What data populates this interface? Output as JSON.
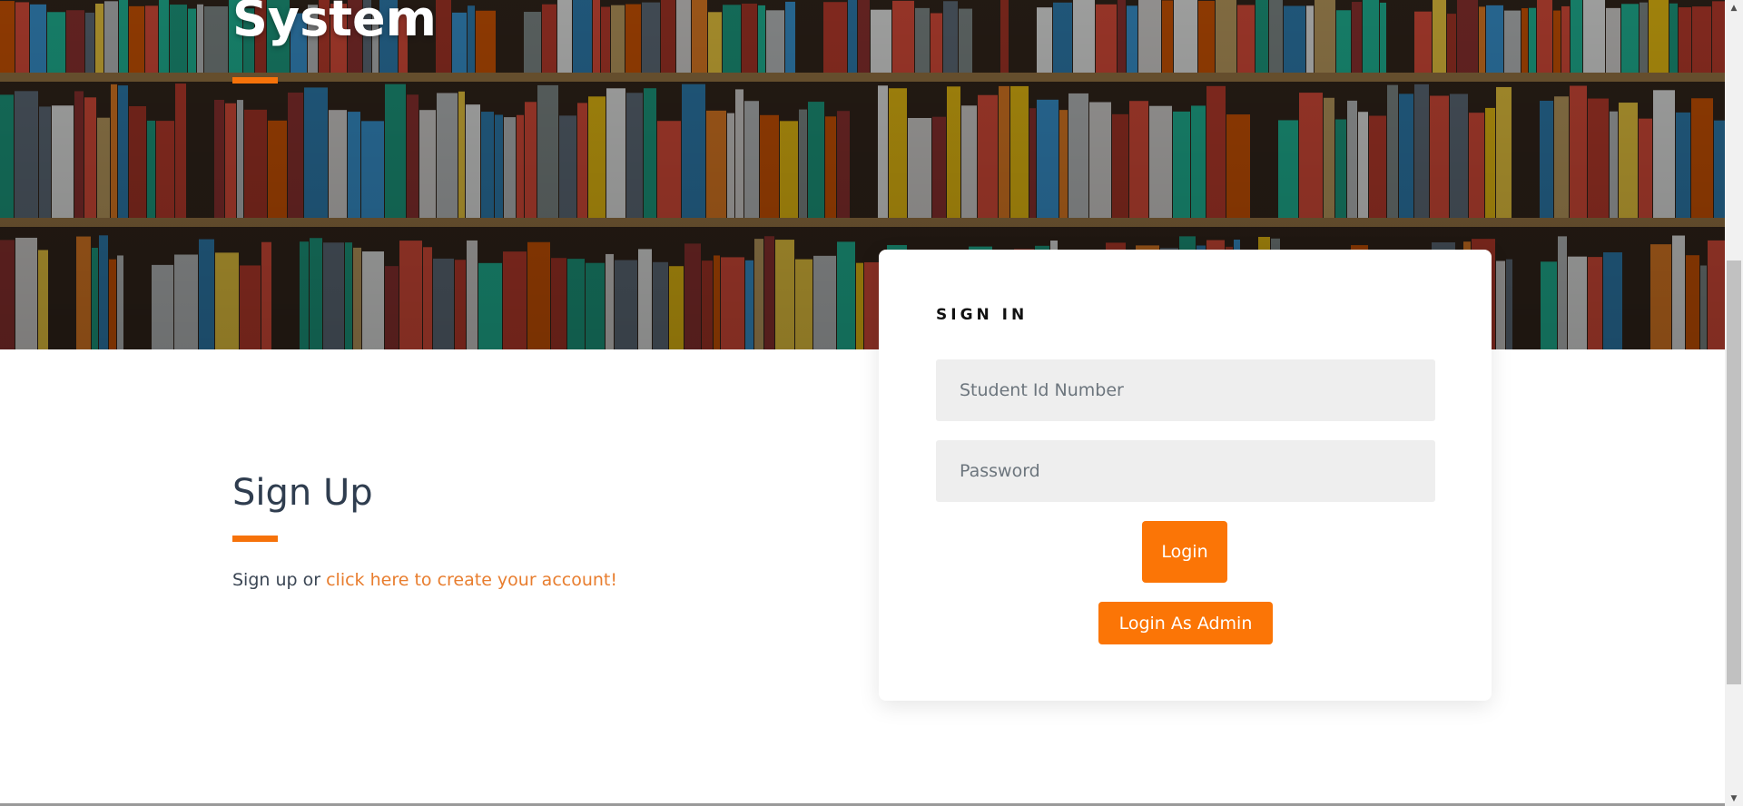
{
  "hero": {
    "title": "System"
  },
  "signup": {
    "title": "Sign Up",
    "text_prefix": "Sign up or ",
    "link_text": "click here to create your account!"
  },
  "signin": {
    "heading": "SIGN IN",
    "student_id_placeholder": "Student Id Number",
    "password_placeholder": "Password",
    "login_label": "Login",
    "admin_login_label": "Login As Admin"
  },
  "colors": {
    "accent": "#fb7506",
    "link": "#e87d2e",
    "heading_text": "#2f3d4f"
  }
}
